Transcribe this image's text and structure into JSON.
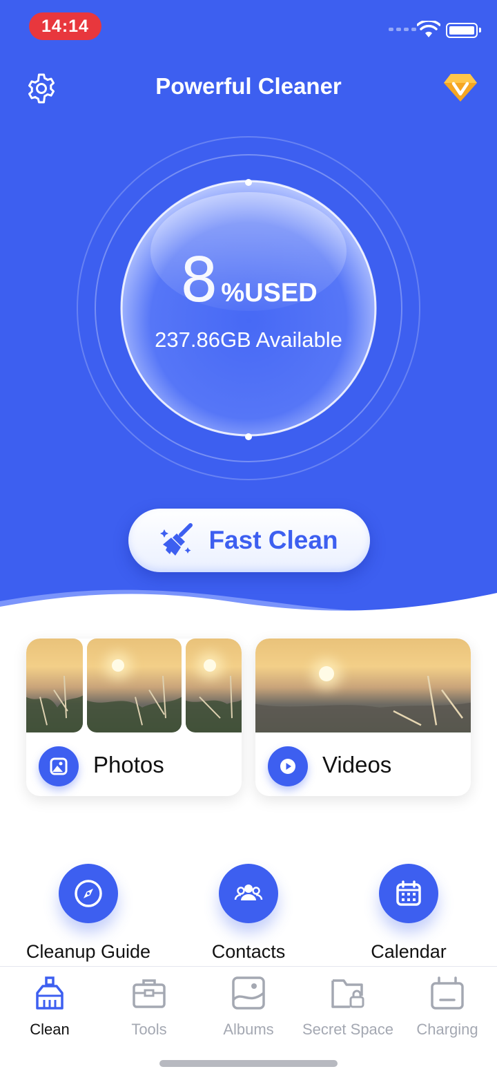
{
  "status_bar": {
    "time": "14:14"
  },
  "header": {
    "title": "Powerful Cleaner",
    "settings_icon": "gear-icon",
    "vip_icon": "vip-diamond-icon"
  },
  "storage": {
    "used_percent": "8",
    "used_label": "%USED",
    "available": "237.86GB Available"
  },
  "fast_clean": {
    "label": "Fast Clean",
    "icon": "broom-icon"
  },
  "media_cards": [
    {
      "label": "Photos",
      "icon": "photo-icon"
    },
    {
      "label": "Videos",
      "icon": "play-icon"
    }
  ],
  "shortcuts": [
    {
      "label": "Cleanup Guide",
      "icon": "compass-icon"
    },
    {
      "label": "Contacts",
      "icon": "contacts-icon"
    },
    {
      "label": "Calendar",
      "icon": "calendar-icon"
    }
  ],
  "tabs": [
    {
      "label": "Clean",
      "icon": "broom-tab-icon",
      "active": true
    },
    {
      "label": "Tools",
      "icon": "toolbox-icon",
      "active": false
    },
    {
      "label": "Albums",
      "icon": "album-icon",
      "active": false
    },
    {
      "label": "Secret Space",
      "icon": "lock-folder-icon",
      "active": false
    },
    {
      "label": "Charging",
      "icon": "battery-icon",
      "active": false
    }
  ],
  "colors": {
    "primary": "#3d5ff0",
    "status_pill": "#e8373d",
    "vip": "#f5a623",
    "tab_inactive": "#a4a8b2"
  }
}
